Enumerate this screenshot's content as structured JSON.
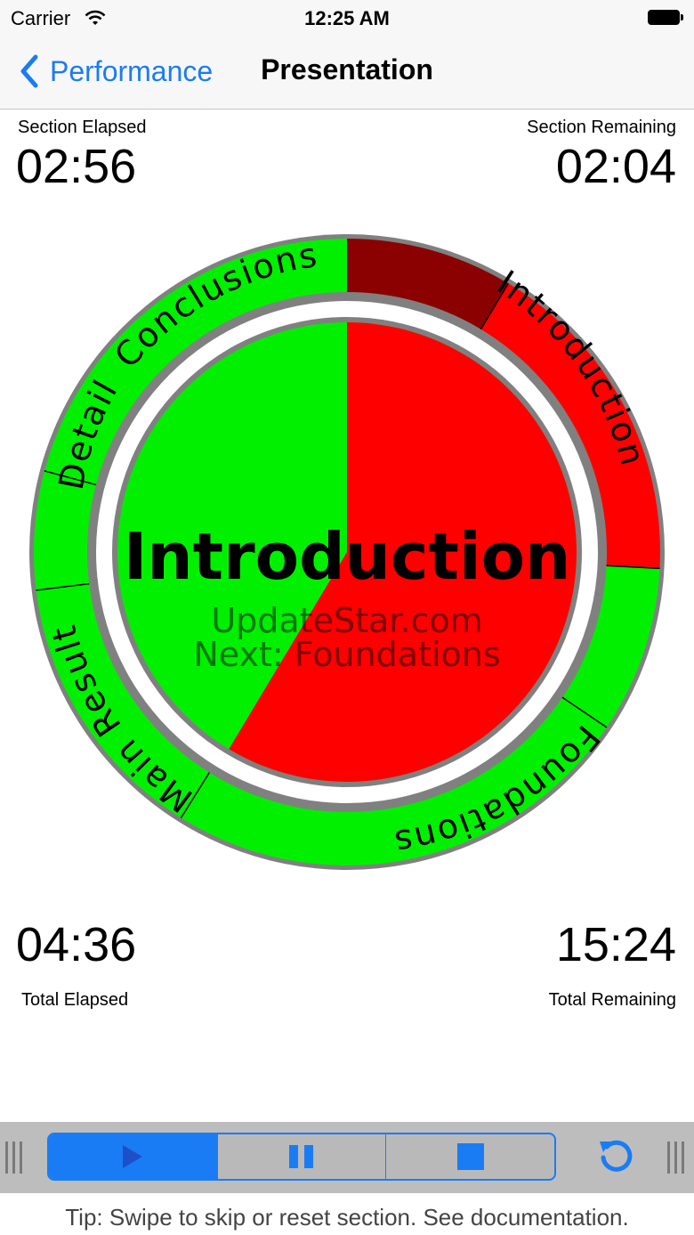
{
  "status_bar": {
    "carrier": "Carrier",
    "time": "12:25 AM",
    "icons": [
      "wifi-icon",
      "battery-icon"
    ]
  },
  "nav": {
    "back_label": "Performance",
    "title": "Presentation",
    "back_icon": "chevron-left-icon"
  },
  "timers": {
    "section_elapsed_label": "Section Elapsed",
    "section_elapsed": "02:56",
    "section_remaining_label": "Section Remaining",
    "section_remaining": "02:04",
    "total_elapsed": "04:36",
    "total_elapsed_label": "Total Elapsed",
    "total_remaining": "15:24",
    "total_remaining_label": "Total Remaining"
  },
  "dial": {
    "current_section": "Introduction",
    "watermark": "UpdateStar.com",
    "next_label": "Next: Foundations",
    "current_progress_fraction": 0.586,
    "sections": [
      {
        "name": "Introduction",
        "state": "current"
      },
      {
        "name": "Foundations",
        "state": "upcoming"
      },
      {
        "name": "Main Result",
        "state": "upcoming"
      },
      {
        "name": "Detail",
        "state": "upcoming"
      },
      {
        "name": "Conclusions",
        "state": "upcoming"
      }
    ],
    "colors": {
      "upcoming": "#00f000",
      "elapsed": "#ff0000",
      "overtime": "#8b0000",
      "ring_border": "#808080"
    }
  },
  "controls": {
    "buttons": [
      "play-icon",
      "pause-icon",
      "stop-icon"
    ],
    "active": "play",
    "reset_icon": "reset-icon",
    "accent": "#1a7cf4"
  },
  "tip": "Tip: Swipe to skip or reset section. See documentation."
}
